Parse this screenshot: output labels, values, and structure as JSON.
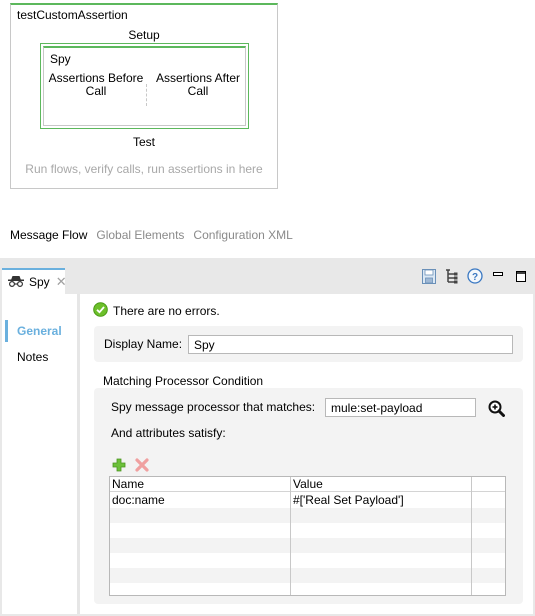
{
  "canvas": {
    "flow_title": "testCustomAssertion",
    "setup_label": "Setup",
    "spy": {
      "title": "Spy",
      "before_label": "Assertions Before Call",
      "after_label": "Assertions After Call"
    },
    "test_label": "Test",
    "test_hint": "Run flows, verify calls, run assertions in here",
    "accent_color": "#5cb85c"
  },
  "editor_tabs": [
    {
      "label": "Message Flow",
      "active": true
    },
    {
      "label": "Global Elements",
      "active": false
    },
    {
      "label": "Configuration XML",
      "active": false
    }
  ],
  "properties": {
    "tab": {
      "label": "Spy",
      "icon": "spy-icon",
      "close": "✕"
    },
    "toolbar": [
      "save-icon",
      "outline-icon",
      "help-icon",
      "minimize-icon",
      "maximize-icon"
    ],
    "sidebar": [
      {
        "label": "General",
        "active": true
      },
      {
        "label": "Notes",
        "active": false
      }
    ],
    "status_text": "There are no errors.",
    "display_name_label": "Display Name:",
    "display_name_value": "Spy",
    "section_title": "Matching Processor Condition",
    "processor_label": "Spy message processor that matches:",
    "processor_value": "mule:set-payload",
    "attributes_label": "And attributes satisfy:",
    "grid": {
      "columns": [
        "Name",
        "Value"
      ],
      "rows": [
        {
          "name": "doc:name",
          "value": "#['Real Set Payload']"
        }
      ]
    },
    "accent_color": "#6ab0de"
  }
}
